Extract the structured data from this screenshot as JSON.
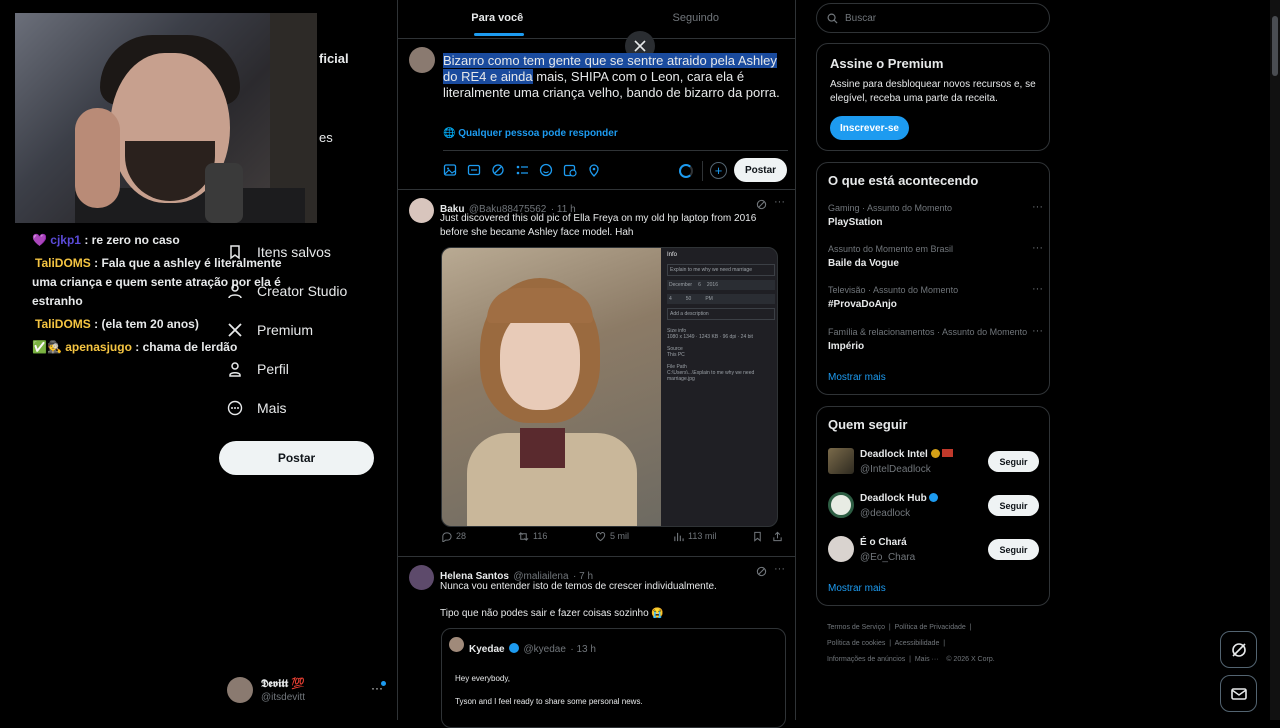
{
  "nav": {
    "items": [
      {
        "label": "Itens salvos"
      },
      {
        "label": "Creator Studio"
      },
      {
        "label": "Premium"
      },
      {
        "label": "Perfil"
      },
      {
        "label": "Mais"
      }
    ],
    "post_label": "Postar",
    "partial": {
      "a": "ficial",
      "b": "es"
    },
    "account": {
      "name": "𝕯𝖊𝖛𝖎𝖙𝖙 💯",
      "handle": "@itsdevitt"
    }
  },
  "chat": [
    {
      "user": "cjkp1",
      "message": ": re zero no caso",
      "user_color": "#5b4bd8"
    },
    {
      "user": "TaliDOMS",
      "message": ": Fala que a ashley é literalmente uma criança e quem sente atração por ela é estranho",
      "user_color": "#f5c542"
    },
    {
      "user": "TaliDOMS",
      "message": ": (ela tem 20 anos)",
      "user_color": "#f5c542"
    },
    {
      "user": "apenasjugo",
      "message": ": chama de lerdão",
      "user_color": "#f5c542"
    }
  ],
  "tabs": [
    {
      "label": "Para você"
    },
    {
      "label": "Seguindo"
    }
  ],
  "compose": {
    "text_selected": "Bizarro como tem gente que se sentre atraido pela Ashley do RE4 e ainda",
    "text_rest": " mais, SHIPA com o Leon, cara ela é literalmente uma criança velho, bando de bizarro da porra.",
    "reply_note": "Qualquer pessoa pode responder",
    "post_label": "Postar"
  },
  "tweets": [
    {
      "name": "Baku",
      "handle": "@Baku88475562",
      "time": "· 11 h",
      "text": "Just discovered this old pic of Ella Freya on my old hp laptop from 2016 before she became Ashley face model. Hah",
      "replies": "28",
      "reposts": "116",
      "likes": "5 mil",
      "views": "113 mil",
      "panel": {
        "title": "Info",
        "field1": "Explain to me why we need marriage",
        "month": "December",
        "day": "6",
        "year": "2016",
        "a": "4",
        "b": "50",
        "c": "PM",
        "desc": "Add a description",
        "size_label": "Size info",
        "size": "1080 x 1349 · 1243 KB · 96 dpi · 24 bit",
        "source_label": "Source",
        "source": "This PC",
        "path_label": "File Path",
        "path": "C:\\Users\\...\\Explain to me why we need marriage.jpg"
      }
    },
    {
      "name": "Helena Santos",
      "handle": "@maliailena",
      "time": "· 7 h",
      "text1": "Nunca vou entender isto de temos de crescer individualmente.",
      "text2": "Tipo que não podes sair e fazer coisas sozinho 😭",
      "quote": {
        "name": "Kyedae",
        "handle": "@kyedae",
        "time": "· 13 h",
        "line1": "Hey everybody,",
        "line2": "Tyson and I feel ready to share some personal news."
      }
    }
  ],
  "search": {
    "placeholder": "Buscar"
  },
  "premium": {
    "title": "Assine o Premium",
    "text": "Assine para desbloquear novos recursos e, se elegível, receba uma parte da receita.",
    "button": "Inscrever-se"
  },
  "trends": {
    "title": "O que está acontecendo",
    "items": [
      {
        "meta": "Gaming · Assunto do Momento",
        "name": "PlayStation"
      },
      {
        "meta": "Assunto do Momento em Brasil",
        "name": "Baile da Vogue"
      },
      {
        "meta": "Televisão · Assunto do Momento",
        "name": "#ProvaDoAnjo"
      },
      {
        "meta": "Família & relacionamentos · Assunto do Momento",
        "name": "Império"
      }
    ],
    "more": "Mostrar mais"
  },
  "follow": {
    "title": "Quem seguir",
    "items": [
      {
        "name": "Deadlock Intel",
        "handle": "@IntelDeadlock",
        "button": "Seguir"
      },
      {
        "name": "Deadlock Hub",
        "handle": "@deadlock",
        "button": "Seguir"
      },
      {
        "name": "É o Chará",
        "handle": "@Eo_Chara",
        "button": "Seguir"
      }
    ],
    "more": "Mostrar mais"
  },
  "footer": {
    "l1": "Termos de Serviço",
    "l2": "Política de Privacidade",
    "l3": "Política de cookies",
    "l4": "Acessibilidade",
    "l5": "Informações de anúncios",
    "l6": "Mais ···",
    "copy": "© 2026 X Corp."
  },
  "colors": {
    "accent": "#1d9bf0",
    "selection": "#1a4b9e",
    "border": "#2f3336"
  }
}
